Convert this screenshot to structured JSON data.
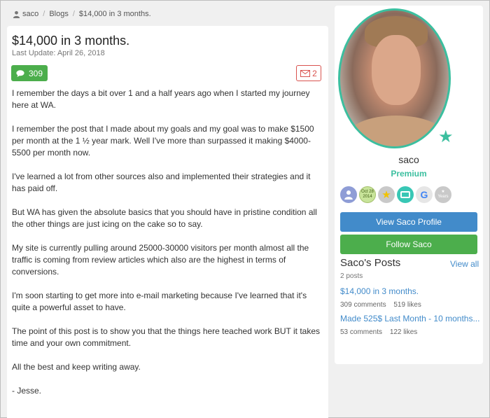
{
  "breadcrumb": {
    "user": "saco",
    "blogs": "Blogs",
    "current": "$14,000 in 3 months."
  },
  "post": {
    "title": "$14,000 in 3 months.",
    "last_update": "Last Update: April 26, 2018",
    "comments_count": "309",
    "messages_count": "2",
    "paragraphs": [
      "I remember the days a bit over 1 and a half years ago when I started my journey here at WA.",
      "I remember the post that I made about my goals and my goal was to make $1500 per month at the 1 ½ year mark. Well I've more than surpassed it making $4000-5500 per month now.",
      "I've learned a lot from other sources also and implemented their strategies and it has paid off.",
      "But WA has given the absolute basics that you should have in pristine condition all the other things are just icing on the cake so to say.",
      "My site is currently pulling around 25000-30000 visitors per month almost all the traffic is coming from review articles which also are the highest in terms of conversions.",
      "I'm soon starting to get more into e-mail marketing because I've learned that it's quite a powerful asset to have.",
      "The point of this post is to show you that the things here teached work BUT it takes time and your own commitment.",
      "All the best and keep writing away.",
      "- Jesse."
    ]
  },
  "profile": {
    "username": "saco",
    "membership": "Premium",
    "badges": {
      "date_month": "Oct 28",
      "date_year": "2014",
      "google": "G",
      "years_label": "Years"
    },
    "view_profile_label": "View Saco Profile",
    "follow_label": "Follow Saco",
    "posts_heading": "Saco's Posts",
    "view_all_label": "View all",
    "posts_count": "2 posts",
    "posts": [
      {
        "title": "$14,000 in 3 months.",
        "comments": "309 comments",
        "likes": "519 likes"
      },
      {
        "title": "Made 525$ Last Month - 10 months...",
        "comments": "53 comments",
        "likes": "122 likes"
      }
    ]
  },
  "colors": {
    "accent_green": "#4cae4c",
    "accent_blue": "#428bca",
    "premium_teal": "#3bbf9f",
    "mail_red": "#d9534f"
  },
  "icons": [
    "user-icon",
    "comment-icon",
    "envelope-icon",
    "star-icon"
  ]
}
